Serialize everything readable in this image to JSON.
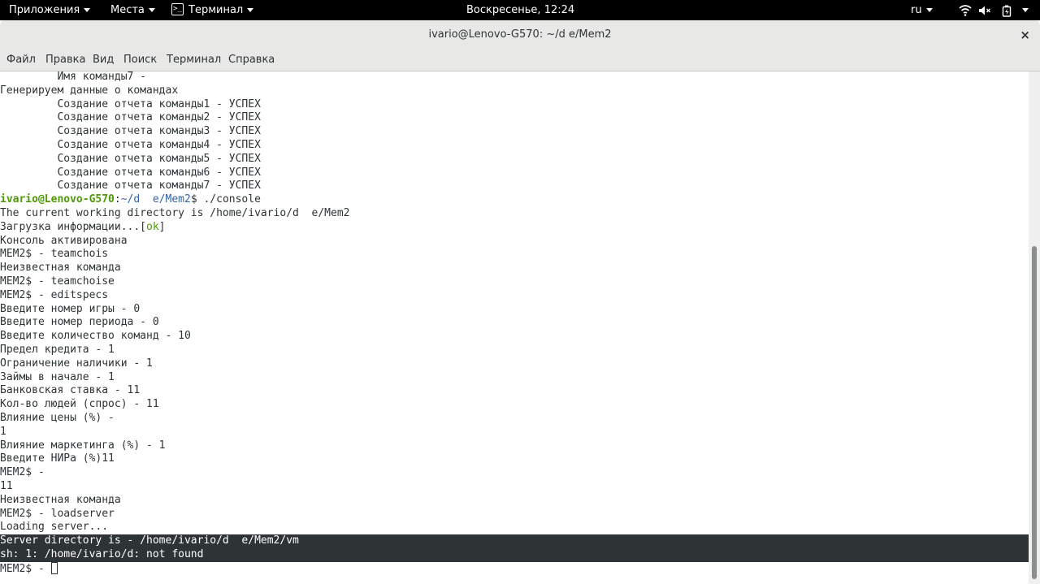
{
  "topbar": {
    "apps": "Приложения",
    "places": "Места",
    "terminal": "Терминал",
    "terminal_icon": ">_",
    "clock": "Воскресенье, 12:24",
    "lang": "ru",
    "icons": [
      "wifi-icon",
      "volume-muted-icon",
      "battery-icon",
      "power-menu-icon"
    ]
  },
  "window": {
    "title": "ivario@Lenovo-G570: ~/d  e/Mem2",
    "close": "×"
  },
  "menu": [
    "Файл",
    "Правка",
    "Вид",
    "Поиск",
    "Терминал",
    "Справка"
  ],
  "terminal": {
    "lines": [
      "         Имя команды7 - ",
      "Генерируем данные о командах",
      "         Создание отчета команды1 - УСПЕХ",
      "         Создание отчета команды2 - УСПЕХ",
      "         Создание отчета команды3 - УСПЕХ",
      "         Создание отчета команды4 - УСПЕХ",
      "         Создание отчета команды5 - УСПЕХ",
      "         Создание отчета команды6 - УСПЕХ",
      "         Создание отчета команды7 - УСПЕХ"
    ],
    "prompt": {
      "user_host": "ivario@Lenovo-G570",
      "sep": ":",
      "path": "~/d  e/Mem2",
      "cmd": "$ ./console"
    },
    "lines2": [
      "The current working directory is /home/ivario/d  e/Mem2"
    ],
    "loading": {
      "text": "Загрузка информации...[",
      "ok": "ok",
      "close": "]"
    },
    "lines3": [
      "Консоль активирована",
      "MEM2$ - teamchois",
      "Неизвестная команда",
      "MEM2$ - teamchoise",
      "MEM2$ - editspecs",
      "Введите номер игры - 0",
      "Введите номер периода - 0",
      "Введите количество команд - 10",
      "Предел кредита - 1",
      "Ограничение наличики - 1",
      "Займы в начале - 1",
      "Банковская ставка - 11",
      "Кол-во людей (спрос) - 11",
      "Влияние цены (%) - ",
      "1",
      "Влияние маркетинга (%) - 1",
      "Введите НИРа (%)11",
      "MEM2$ - ",
      "11",
      "Неизвестная команда",
      "MEM2$ - loadserver",
      "Loading server..."
    ],
    "selected": [
      "Server directory is - /home/ivario/d  e/Mem2/vm",
      "sh: 1: /home/ivario/d: not found"
    ],
    "last_prompt": "MEM2$ - "
  }
}
